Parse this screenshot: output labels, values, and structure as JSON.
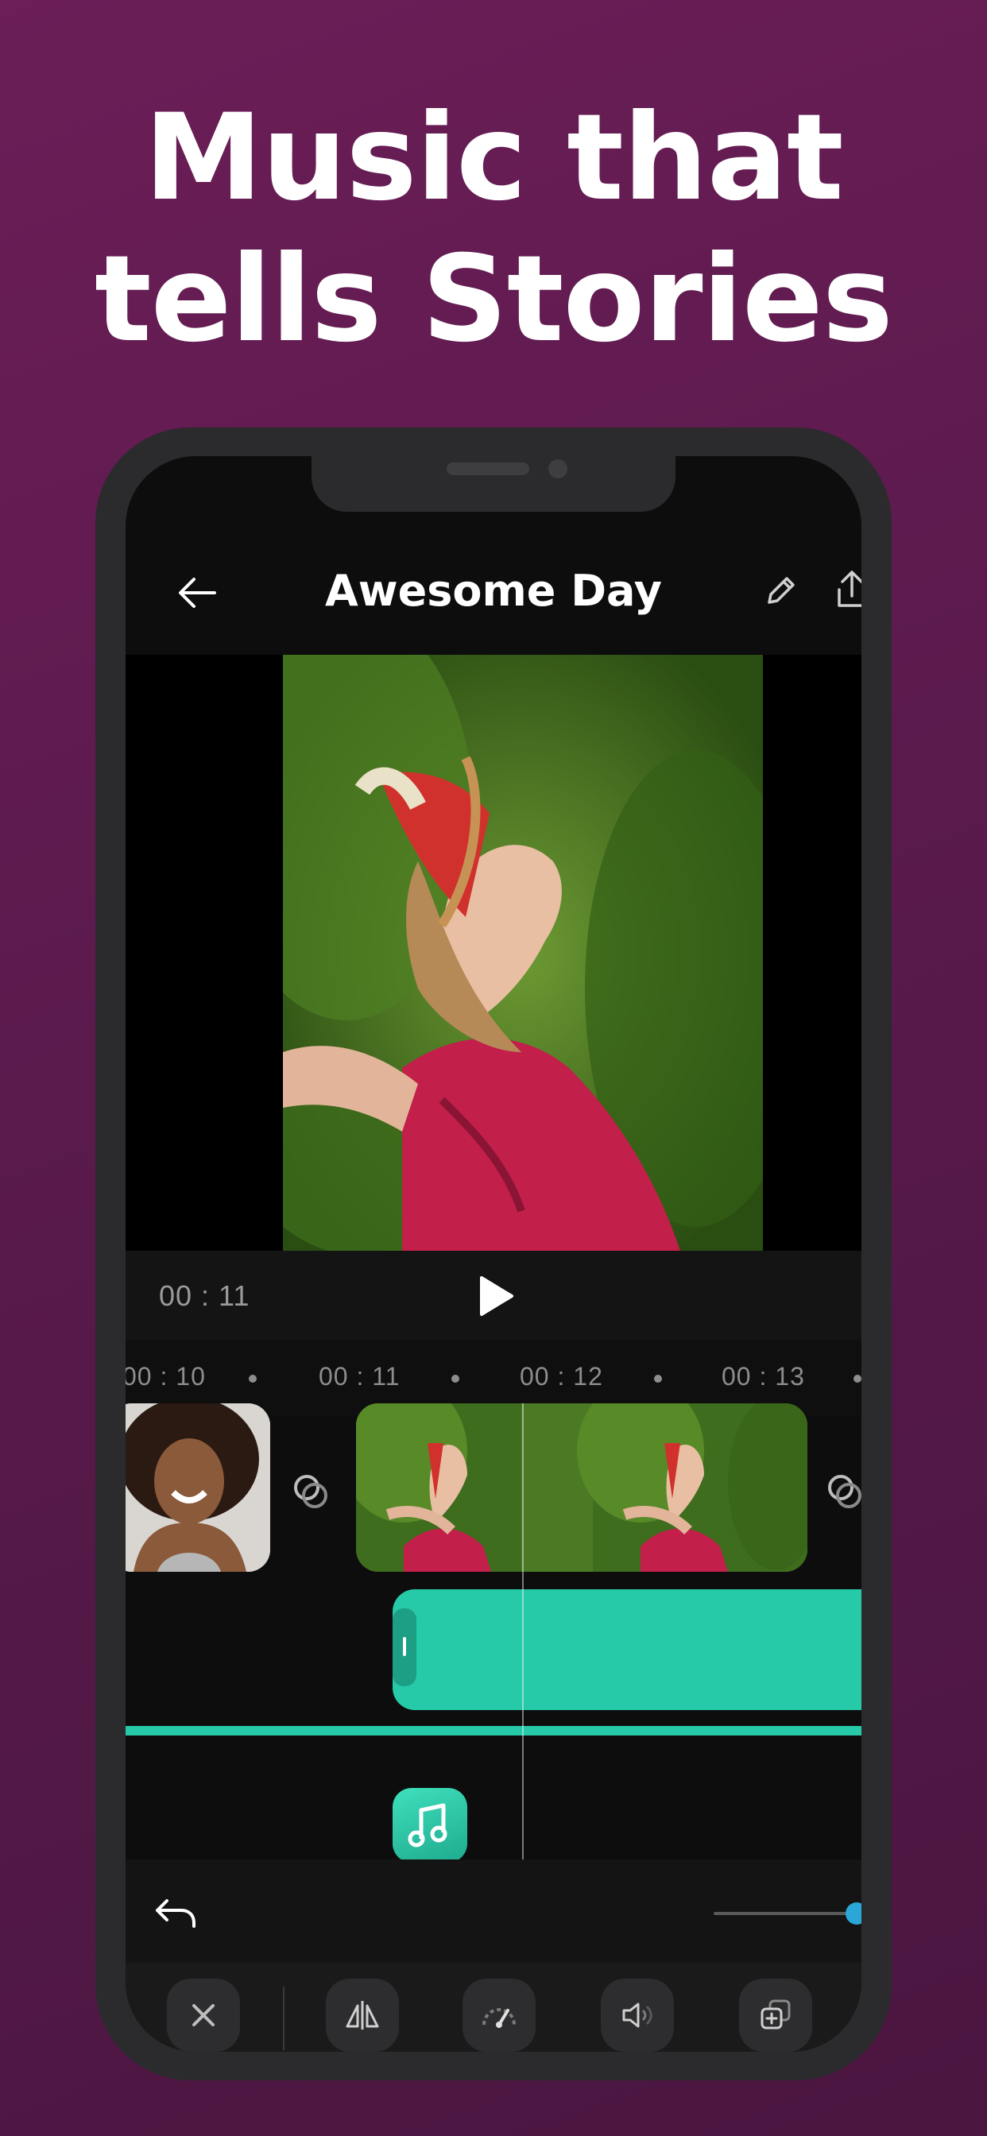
{
  "headline": {
    "line1": "Music that",
    "line2": "tells Stories"
  },
  "editor": {
    "title": "Awesome Day",
    "current_time": "00 : 11",
    "timeline_ticks": [
      "00 : 10",
      "00 : 11",
      "00 : 12",
      "00 : 13"
    ],
    "icons": {
      "back": "arrow-left-icon",
      "edit": "pencil-icon",
      "share": "share-icon",
      "play": "play-icon",
      "undo": "undo-icon",
      "transition": "transition-icon",
      "music": "music-note-icon",
      "toolbar": [
        "close-icon",
        "mirror-icon",
        "speed-icon",
        "volume-icon",
        "duplicate-icon"
      ]
    }
  },
  "colors": {
    "background": "#5a1a4c",
    "accent_teal": "#26c9a8",
    "phone_frame": "#2b2b2d",
    "slider_knob": "#2aa7d6"
  }
}
